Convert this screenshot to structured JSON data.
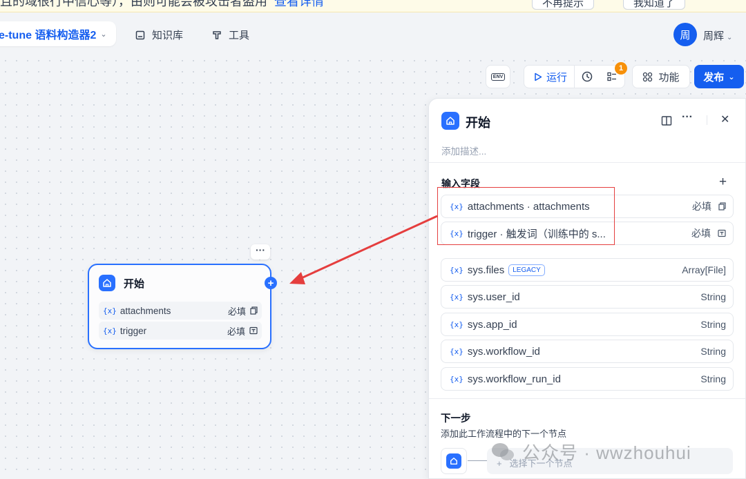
{
  "banner": {
    "text": "且的域很行中信心等），由则可能会被攻击者盗用",
    "link": "查看详情",
    "btn1": "不再提示",
    "btn2": "我知道了"
  },
  "header": {
    "app_name": "e-tune 语料构造器2",
    "nav": [
      {
        "label": "知识库",
        "icon": "book-icon"
      },
      {
        "label": "工具",
        "icon": "tool-icon"
      }
    ],
    "avatar": "周",
    "username": "周辉"
  },
  "toolbar": {
    "env": "ENV",
    "run": "运行",
    "badge": "1",
    "feature": "功能",
    "publish": "发布"
  },
  "node": {
    "title": "开始",
    "vars": [
      {
        "name": "attachments",
        "required": "必填",
        "icon": "file-icon"
      },
      {
        "name": "trigger",
        "required": "必填",
        "icon": "text-icon"
      }
    ]
  },
  "panel": {
    "title": "开始",
    "description_placeholder": "添加描述...",
    "input_section": "输入字段",
    "fields": [
      {
        "name": "attachments · attachments",
        "required": "必填",
        "icon": "file-icon"
      },
      {
        "name": "trigger · 触发词（训练中的 s...",
        "required": "必填",
        "icon": "text-icon"
      }
    ],
    "sys_fields": [
      {
        "name": "sys.files",
        "tag": "LEGACY",
        "type": "Array[File]"
      },
      {
        "name": "sys.user_id",
        "type": "String"
      },
      {
        "name": "sys.app_id",
        "type": "String"
      },
      {
        "name": "sys.workflow_id",
        "type": "String"
      },
      {
        "name": "sys.workflow_run_id",
        "type": "String"
      }
    ],
    "next_title": "下一步",
    "next_desc": "添加此工作流程中的下一个节点",
    "next_select": "选择下一个节点"
  },
  "var_mark": "{x}",
  "watermark": "公众号 · wwzhouhui",
  "colors": {
    "accent": "#155eef",
    "node_border": "#2970ff",
    "highlight": "#e53e3e",
    "badge": "#f79009"
  }
}
